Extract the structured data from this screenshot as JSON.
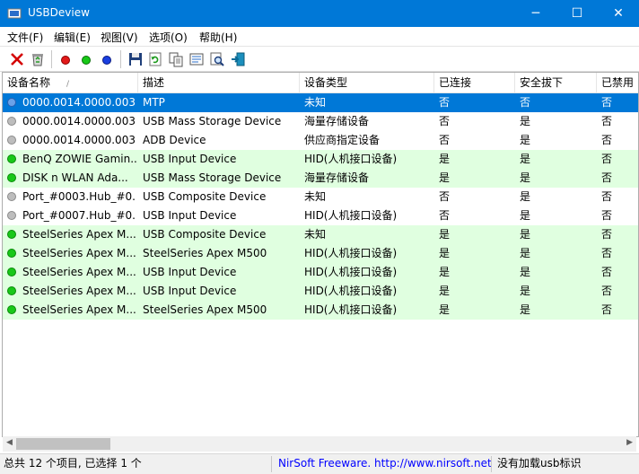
{
  "window": {
    "title": "USBDeview",
    "minimize_glyph": "─",
    "maximize_glyph": "☐",
    "close_glyph": "✕"
  },
  "menu": [
    "文件(F)",
    "编辑(E)",
    "视图(V)",
    "选项(O)",
    "帮助(H)"
  ],
  "toolbar_icons": [
    "delete-icon",
    "recycle-icon",
    "red-dot-icon",
    "green-dot-icon",
    "blue-dot-icon",
    "save-icon",
    "refresh-icon",
    "copy-icon",
    "properties-icon",
    "find-icon",
    "exit-icon"
  ],
  "columns": [
    "设备名称",
    "描述",
    "设备类型",
    "已连接",
    "安全拔下",
    "已禁用"
  ],
  "sort_indicator": "/",
  "rows": [
    {
      "name": "0000.0014.0000.003....",
      "desc": "MTP",
      "type": "未知",
      "connected": "否",
      "safe": "否",
      "disabled": "否",
      "status": "blue",
      "selected": true,
      "highlight": false
    },
    {
      "name": "0000.0014.0000.003....",
      "desc": "USB Mass Storage Device",
      "type": "海量存储设备",
      "connected": "否",
      "safe": "是",
      "disabled": "否",
      "status": "gray",
      "selected": false,
      "highlight": false
    },
    {
      "name": "0000.0014.0000.003....",
      "desc": "ADB Device",
      "type": "供应商指定设备",
      "connected": "否",
      "safe": "是",
      "disabled": "否",
      "status": "gray",
      "selected": false,
      "highlight": false
    },
    {
      "name": "BenQ ZOWIE Gamin...",
      "desc": "USB Input Device",
      "type": "HID(人机接口设备)",
      "connected": "是",
      "safe": "是",
      "disabled": "否",
      "status": "green",
      "selected": false,
      "highlight": true
    },
    {
      "name": "DISK  n WLAN Ada...",
      "desc": "USB Mass Storage Device",
      "type": "海量存储设备",
      "connected": "是",
      "safe": "是",
      "disabled": "否",
      "status": "green",
      "selected": false,
      "highlight": true
    },
    {
      "name": "Port_#0003.Hub_#0...",
      "desc": "USB Composite Device",
      "type": "未知",
      "connected": "否",
      "safe": "是",
      "disabled": "否",
      "status": "gray",
      "selected": false,
      "highlight": false
    },
    {
      "name": "Port_#0007.Hub_#0...",
      "desc": "USB Input Device",
      "type": "HID(人机接口设备)",
      "connected": "否",
      "safe": "是",
      "disabled": "否",
      "status": "gray",
      "selected": false,
      "highlight": false
    },
    {
      "name": "SteelSeries Apex M...",
      "desc": "USB Composite Device",
      "type": "未知",
      "connected": "是",
      "safe": "是",
      "disabled": "否",
      "status": "green",
      "selected": false,
      "highlight": true
    },
    {
      "name": "SteelSeries Apex M...",
      "desc": "SteelSeries Apex M500",
      "type": "HID(人机接口设备)",
      "connected": "是",
      "safe": "是",
      "disabled": "否",
      "status": "green",
      "selected": false,
      "highlight": true
    },
    {
      "name": "SteelSeries Apex M...",
      "desc": "USB Input Device",
      "type": "HID(人机接口设备)",
      "connected": "是",
      "safe": "是",
      "disabled": "否",
      "status": "green",
      "selected": false,
      "highlight": true
    },
    {
      "name": "SteelSeries Apex M...",
      "desc": "USB Input Device",
      "type": "HID(人机接口设备)",
      "connected": "是",
      "safe": "是",
      "disabled": "否",
      "status": "green",
      "selected": false,
      "highlight": true
    },
    {
      "name": "SteelSeries Apex M...",
      "desc": "SteelSeries Apex M500",
      "type": "HID(人机接口设备)",
      "connected": "是",
      "safe": "是",
      "disabled": "否",
      "status": "green",
      "selected": false,
      "highlight": true
    }
  ],
  "status": {
    "count": "总共 12 个项目, 已选择 1 个",
    "link": "NirSoft Freeware.  http://www.nirsoft.net",
    "right": "没有加载usb标识"
  },
  "colors": {
    "titlebar": "#0078d7",
    "selected_row": "#0078d7",
    "connected_row": "#e0ffe0",
    "link_text": "#0000ff"
  }
}
